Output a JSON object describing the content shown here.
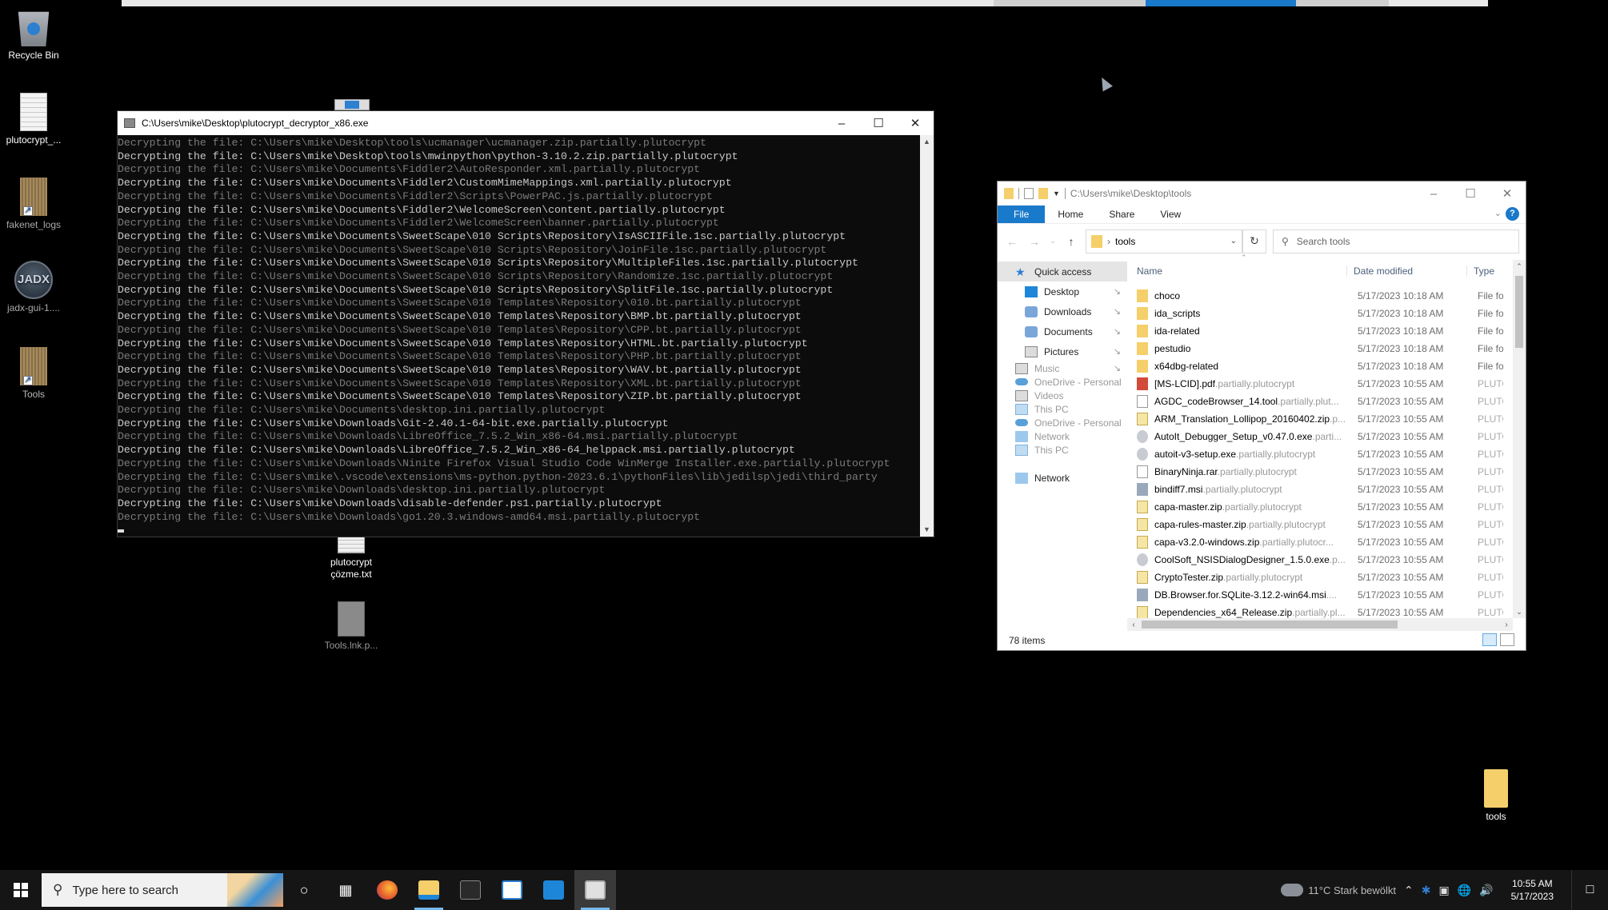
{
  "desktop": {
    "icons": [
      {
        "label": "Recycle Bin",
        "icon": "recycle-bin-icon"
      },
      {
        "label": "plutocrypt_...",
        "icon": "text-document-icon"
      },
      {
        "label": "fakenet_logs",
        "icon": "folder-shortcut-icon"
      },
      {
        "label": "jadx-gui-1....",
        "icon": "jadx-app-icon"
      },
      {
        "label": "Tools",
        "icon": "folder-shortcut-icon"
      },
      {
        "label": "plutocrypt\nçözme.txt",
        "icon": "text-document-icon"
      },
      {
        "label": "Tools.lnk.p...",
        "icon": "encrypted-file-icon"
      },
      {
        "label": "tools",
        "icon": "folder-icon"
      }
    ]
  },
  "console": {
    "title": "C:\\Users\\mike\\Desktop\\plutocrypt_decryptor_x86.exe",
    "lines": [
      {
        "text": "Decrypting the file: C:\\Users\\mike\\Desktop\\tools\\ucmanager\\ucmanager.zip.partially.plutocrypt",
        "dim": true
      },
      {
        "text": "Decrypting the file: C:\\Users\\mike\\Desktop\\tools\\mwinpython\\python-3.10.2.zip.partially.plutocrypt",
        "dim": false
      },
      {
        "text": "Decrypting the file: C:\\Users\\mike\\Documents\\Fiddler2\\AutoResponder.xml.partially.plutocrypt",
        "dim": true
      },
      {
        "text": "Decrypting the file: C:\\Users\\mike\\Documents\\Fiddler2\\CustomMimeMappings.xml.partially.plutocrypt",
        "dim": false
      },
      {
        "text": "Decrypting the file: C:\\Users\\mike\\Documents\\Fiddler2\\Scripts\\PowerPAC.js.partially.plutocrypt",
        "dim": true
      },
      {
        "text": "Decrypting the file: C:\\Users\\mike\\Documents\\Fiddler2\\WelcomeScreen\\content.partially.plutocrypt",
        "dim": false
      },
      {
        "text": "Decrypting the file: C:\\Users\\mike\\Documents\\Fiddler2\\WelcomeScreen\\banner.partially.plutocrypt",
        "dim": true
      },
      {
        "text": "Decrypting the file: C:\\Users\\mike\\Documents\\SweetScape\\010 Scripts\\Repository\\IsASCIIFile.1sc.partially.plutocrypt",
        "dim": false
      },
      {
        "text": "Decrypting the file: C:\\Users\\mike\\Documents\\SweetScape\\010 Scripts\\Repository\\JoinFile.1sc.partially.plutocrypt",
        "dim": true
      },
      {
        "text": "Decrypting the file: C:\\Users\\mike\\Documents\\SweetScape\\010 Scripts\\Repository\\MultipleFiles.1sc.partially.plutocrypt",
        "dim": false
      },
      {
        "text": "Decrypting the file: C:\\Users\\mike\\Documents\\SweetScape\\010 Scripts\\Repository\\Randomize.1sc.partially.plutocrypt",
        "dim": true
      },
      {
        "text": "Decrypting the file: C:\\Users\\mike\\Documents\\SweetScape\\010 Scripts\\Repository\\SplitFile.1sc.partially.plutocrypt",
        "dim": false
      },
      {
        "text": "Decrypting the file: C:\\Users\\mike\\Documents\\SweetScape\\010 Templates\\Repository\\010.bt.partially.plutocrypt",
        "dim": true
      },
      {
        "text": "Decrypting the file: C:\\Users\\mike\\Documents\\SweetScape\\010 Templates\\Repository\\BMP.bt.partially.plutocrypt",
        "dim": false
      },
      {
        "text": "Decrypting the file: C:\\Users\\mike\\Documents\\SweetScape\\010 Templates\\Repository\\CPP.bt.partially.plutocrypt",
        "dim": true
      },
      {
        "text": "Decrypting the file: C:\\Users\\mike\\Documents\\SweetScape\\010 Templates\\Repository\\HTML.bt.partially.plutocrypt",
        "dim": false
      },
      {
        "text": "Decrypting the file: C:\\Users\\mike\\Documents\\SweetScape\\010 Templates\\Repository\\PHP.bt.partially.plutocrypt",
        "dim": true
      },
      {
        "text": "Decrypting the file: C:\\Users\\mike\\Documents\\SweetScape\\010 Templates\\Repository\\WAV.bt.partially.plutocrypt",
        "dim": false
      },
      {
        "text": "Decrypting the file: C:\\Users\\mike\\Documents\\SweetScape\\010 Templates\\Repository\\XML.bt.partially.plutocrypt",
        "dim": true
      },
      {
        "text": "Decrypting the file: C:\\Users\\mike\\Documents\\SweetScape\\010 Templates\\Repository\\ZIP.bt.partially.plutocrypt",
        "dim": false
      },
      {
        "text": "Decrypting the file: C:\\Users\\mike\\Documents\\desktop.ini.partially.plutocrypt",
        "dim": true
      },
      {
        "text": "Decrypting the file: C:\\Users\\mike\\Downloads\\Git-2.40.1-64-bit.exe.partially.plutocrypt",
        "dim": false
      },
      {
        "text": "Decrypting the file: C:\\Users\\mike\\Downloads\\LibreOffice_7.5.2_Win_x86-64.msi.partially.plutocrypt",
        "dim": true
      },
      {
        "text": "Decrypting the file: C:\\Users\\mike\\Downloads\\LibreOffice_7.5.2_Win_x86-64_helppack.msi.partially.plutocrypt",
        "dim": false
      },
      {
        "text": "Decrypting the file: C:\\Users\\mike\\Downloads\\Ninite Firefox Visual Studio Code WinMerge Installer.exe.partially.plutocrypt",
        "dim": true
      },
      {
        "text": "Decrypting the file: C:\\Users\\mike\\.vscode\\extensions\\ms-python.python-2023.6.1\\pythonFiles\\lib\\jedilsp\\jedi\\third_party",
        "dim": true
      },
      {
        "text": "Decrypting the file: C:\\Users\\mike\\Downloads\\desktop.ini.partially.plutocrypt",
        "dim": true
      },
      {
        "text": "Decrypting the file: C:\\Users\\mike\\Downloads\\disable-defender.ps1.partially.plutocrypt",
        "dim": false
      },
      {
        "text": "Decrypting the file: C:\\Users\\mike\\Downloads\\go1.20.3.windows-amd64.msi.partially.plutocrypt",
        "dim": true
      }
    ]
  },
  "explorer": {
    "title_path": "C:\\Users\\mike\\Desktop\\tools",
    "ribbon_tabs": [
      "File",
      "Home",
      "Share",
      "View"
    ],
    "address_crumb": "tools",
    "search_placeholder": "Search tools",
    "nav_pane": [
      {
        "label": "Quick access",
        "icon": "star",
        "selected": true
      },
      {
        "label": "Desktop",
        "icon": "desk",
        "pinned": true
      },
      {
        "label": "Downloads",
        "icon": "dl",
        "pinned": true
      },
      {
        "label": "Documents",
        "icon": "dl",
        "pinned": true
      },
      {
        "label": "Pictures",
        "icon": "pic",
        "pinned": true
      },
      {
        "label": "Music",
        "icon": "pic",
        "pinned": true,
        "ghost": true
      },
      {
        "label": "OneDrive - Personal",
        "icon": "cloud",
        "ghost": true
      },
      {
        "label": "Videos",
        "icon": "pic",
        "ghost": true
      },
      {
        "label": "This PC",
        "icon": "pc",
        "ghost": true
      },
      {
        "label": "OneDrive - Personal",
        "icon": "cloud",
        "ghost": true
      },
      {
        "label": "Network",
        "icon": "net",
        "ghost": true
      },
      {
        "label": "This PC",
        "icon": "pc",
        "ghost": true
      },
      {
        "label": "Network",
        "icon": "net",
        "ghost": false
      }
    ],
    "columns": {
      "name": "Name",
      "date": "Date modified",
      "type": "Type"
    },
    "files": [
      {
        "name": "choco",
        "ext": "",
        "date": "5/17/2023 10:18 AM",
        "type": "File fo",
        "icon": "folder"
      },
      {
        "name": "ida_scripts",
        "ext": "",
        "date": "5/17/2023 10:18 AM",
        "type": "File fo",
        "icon": "folder"
      },
      {
        "name": "ida-related",
        "ext": "",
        "date": "5/17/2023 10:18 AM",
        "type": "File fo",
        "icon": "folder"
      },
      {
        "name": "pestudio",
        "ext": "",
        "date": "5/17/2023 10:18 AM",
        "type": "File fo",
        "icon": "folder"
      },
      {
        "name": "x64dbg-related",
        "ext": "",
        "date": "5/17/2023 10:18 AM",
        "type": "File fo",
        "icon": "folder"
      },
      {
        "name": "[MS-LCID].pdf",
        "ext": ".partially.plutocrypt",
        "date": "5/17/2023 10:55 AM",
        "type": "PLUTOC",
        "icon": "pdf"
      },
      {
        "name": "AGDC_codeBrowser_14.tool",
        "ext": ".partially.plut...",
        "date": "5/17/2023 10:55 AM",
        "type": "PLUTOC",
        "icon": "file"
      },
      {
        "name": "ARM_Translation_Lollipop_20160402.zip",
        "ext": ".p...",
        "date": "5/17/2023 10:55 AM",
        "type": "PLUTOC",
        "icon": "zip"
      },
      {
        "name": "AutoIt_Debugger_Setup_v0.47.0.exe",
        "ext": ".parti...",
        "date": "5/17/2023 10:55 AM",
        "type": "PLUTOC",
        "icon": "exe"
      },
      {
        "name": "autoit-v3-setup.exe",
        "ext": ".partially.plutocrypt",
        "date": "5/17/2023 10:55 AM",
        "type": "PLUTOC",
        "icon": "exe"
      },
      {
        "name": "BinaryNinja.rar",
        "ext": ".partially.plutocrypt",
        "date": "5/17/2023 10:55 AM",
        "type": "PLUTOC",
        "icon": "file"
      },
      {
        "name": "bindiff7.msi",
        "ext": ".partially.plutocrypt",
        "date": "5/17/2023 10:55 AM",
        "type": "PLUTOC",
        "icon": "msi"
      },
      {
        "name": "capa-master.zip",
        "ext": ".partially.plutocrypt",
        "date": "5/17/2023 10:55 AM",
        "type": "PLUTOC",
        "icon": "zip"
      },
      {
        "name": "capa-rules-master.zip",
        "ext": ".partially.plutocrypt",
        "date": "5/17/2023 10:55 AM",
        "type": "PLUTOC",
        "icon": "zip"
      },
      {
        "name": "capa-v3.2.0-windows.zip",
        "ext": ".partially.plutocr...",
        "date": "5/17/2023 10:55 AM",
        "type": "PLUTOC",
        "icon": "zip"
      },
      {
        "name": "CoolSoft_NSISDialogDesigner_1.5.0.exe",
        "ext": ".p...",
        "date": "5/17/2023 10:55 AM",
        "type": "PLUTOC",
        "icon": "exe"
      },
      {
        "name": "CryptoTester.zip",
        "ext": ".partially.plutocrypt",
        "date": "5/17/2023 10:55 AM",
        "type": "PLUTOC",
        "icon": "zip"
      },
      {
        "name": "DB.Browser.for.SQLite-3.12.2-win64.msi",
        "ext": "....",
        "date": "5/17/2023 10:55 AM",
        "type": "PLUTOC",
        "icon": "msi"
      },
      {
        "name": "Dependencies_x64_Release.zip",
        "ext": ".partially.pl...",
        "date": "5/17/2023 10:55 AM",
        "type": "PLUTOC",
        "icon": "zip"
      }
    ],
    "status": "78 items"
  },
  "taskbar": {
    "search_placeholder": "Type here to search",
    "apps": [
      "cortana",
      "task-view",
      "firefox",
      "file-explorer",
      "terminal",
      "microsoft-store",
      "mail",
      "console"
    ],
    "weather": "11°C Stark bewölkt",
    "time": "10:55 AM",
    "date": "5/17/2023"
  }
}
